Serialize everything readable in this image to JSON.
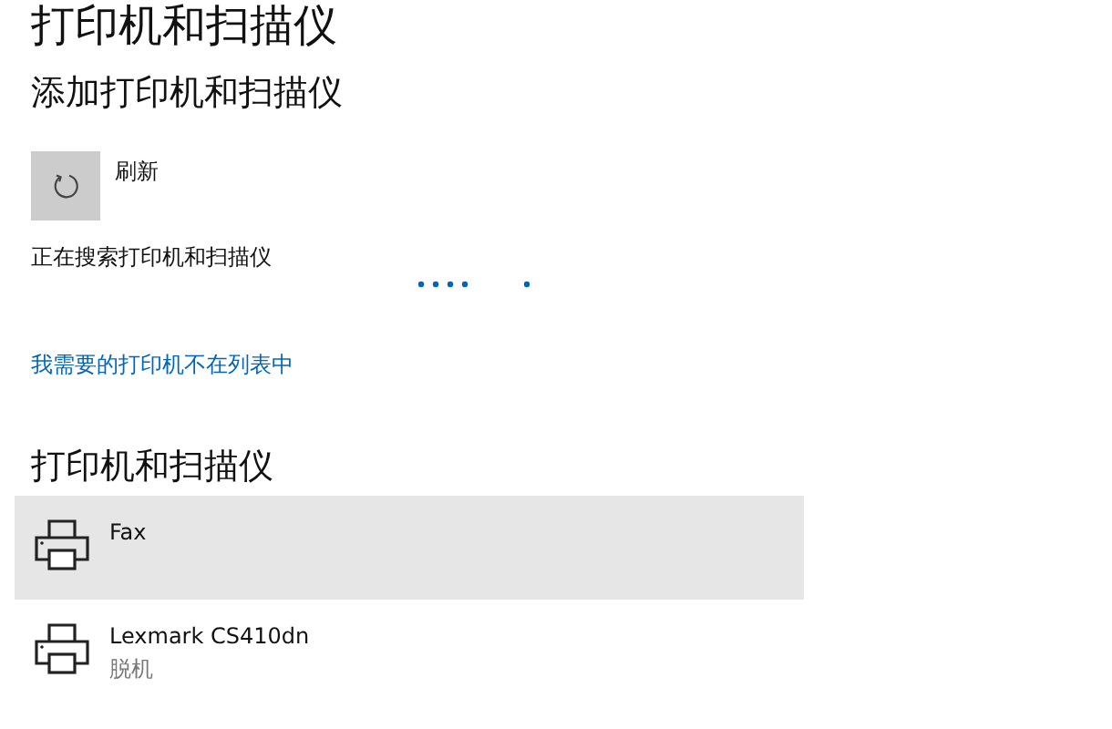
{
  "page_title": "打印机和扫描仪",
  "add_section": {
    "heading": "添加打印机和扫描仪",
    "refresh_label": "刷新",
    "searching_text": "正在搜索打印机和扫描仪",
    "link": "我需要的打印机不在列表中"
  },
  "devices_section": {
    "heading": "打印机和扫描仪",
    "devices": [
      {
        "name": "Fax",
        "highlighted": true
      },
      {
        "name": "Lexmark CS410dn",
        "status": "脱机",
        "highlighted": false
      }
    ]
  }
}
